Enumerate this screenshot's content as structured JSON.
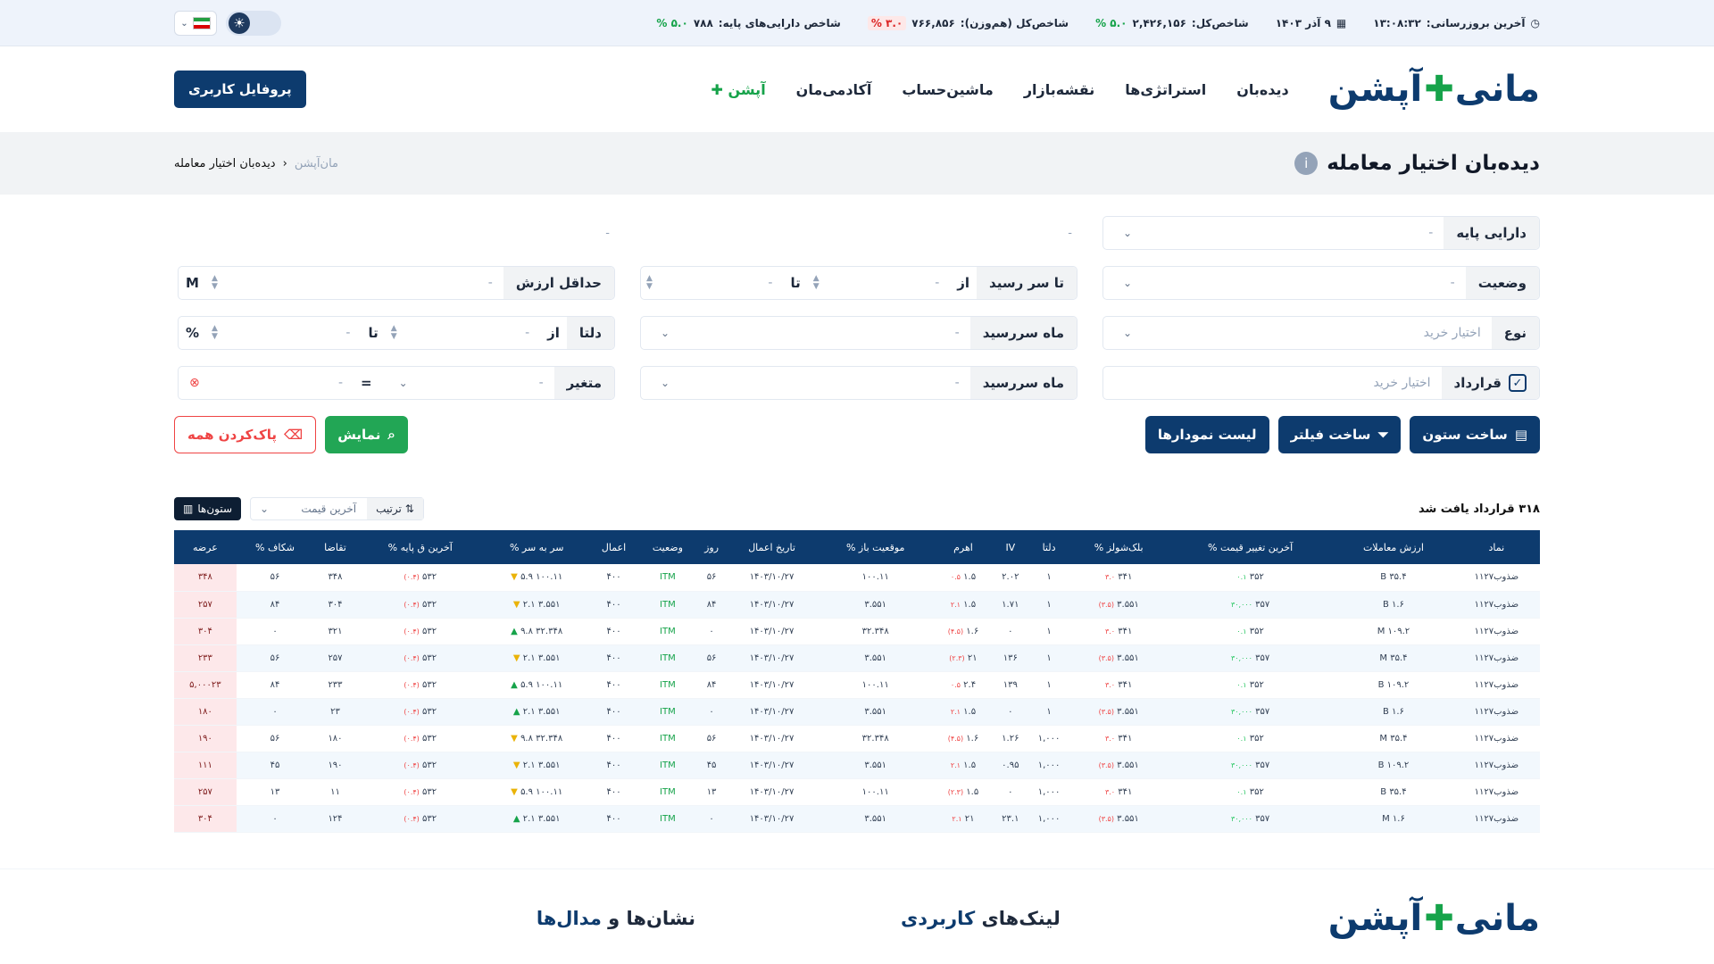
{
  "ticker": {
    "last_update_label": "آخرین بروزرسانی:",
    "last_update_time": "۱۳:۰۸:۳۲",
    "date": "۹ آذر ۱۴۰۳",
    "total_index_label": "شاخص‌کل:",
    "total_index_value": "۲,۴۲۶,۱۵۶",
    "total_index_change": "۵.۰ %",
    "eq_index_label": "شاخص‌کل (هم‌وزن):",
    "eq_index_value": "۷۶۶,۸۵۶",
    "eq_index_change": "۳.۰ %",
    "base_index_label": "شاخص دارایی‌های پایه:",
    "base_index_value": "۷۸۸",
    "base_index_change": "۵.۰ %"
  },
  "header": {
    "logo_a": "مانی",
    "logo_b": "آپشن",
    "nav": [
      "دیده‌بان",
      "استراتژی‌ها",
      "نقشه‌بازار",
      "ماشین‌حساب",
      "آکادمی‌مان",
      "آپشن"
    ],
    "profile": "پروفایل کاربری"
  },
  "page": {
    "title": "دیده‌بان اختیار معامله",
    "breadcrumb_root": "مان‌آپشن",
    "breadcrumb_current": "دیده‌بان اختیار معامله"
  },
  "filters": {
    "base_asset": "دارایی پایه",
    "status": "وضعیت",
    "type": "نوع",
    "type_value": "اختیار خرید",
    "contract": "قرارداد",
    "contract_value": "اختیار خرید",
    "to_maturity": "تا سر رسید",
    "from": "از",
    "to": "تا",
    "maturity_month": "ماه سررسید",
    "min_value": "حداقل ارزش",
    "unit_m": "M",
    "delta": "دلتا",
    "pct": "%",
    "variable": "متغیر",
    "eq": "=",
    "dash": "-"
  },
  "buttons": {
    "columns": "ساخت ستون",
    "filter": "ساخت فیلتر",
    "charts": "لیست نمودارها",
    "show": "نمایش",
    "clear": "پاک‌کردن همه"
  },
  "table": {
    "found": "۳۱۸  قرارداد یافت شد",
    "sort_label": "ترتیب",
    "sort_value": "آخرین قیمت",
    "columns_btn": "ستون‌ها",
    "headers": [
      "نماد",
      "ارزش معاملات",
      "آخرین تغییر قیمت %",
      "بلک‌شولز %",
      "دلتا",
      "IV",
      "اهرم",
      "موقعیت باز %",
      "تاریخ اعمال",
      "روز",
      "وضعیت",
      "اعمال",
      "سر به سر %",
      "آخرین ق پایه %",
      "تقاضا",
      "شکاف %",
      "عرضه"
    ],
    "rows": [
      [
        "ضذوب۱۱۲۷",
        "۳۵.۴ B",
        "۰.۱",
        "۳۵۲",
        "۳.۰",
        "۳۴۱",
        "۱",
        "۲.۰۲",
        "۱.۵",
        "۰.۵",
        "۱۰۰.۱۱",
        "۱۴۰۳/۱۰/۲۷",
        "۵۶",
        "ITM",
        "۴۰۰",
        "۵.۹",
        "▼",
        "۱۰۰.۱۱",
        "(۰.۴)",
        "۵۳۲",
        "۳۴۸",
        "۵۶",
        "۳۴۸"
      ],
      [
        "ضذوب۱۱۲۷",
        "۱.۶ B",
        "۳۰,۰۰۰",
        "۳۵۷",
        "(۳.۵)",
        "۳.۵۵۱",
        "۱",
        "۱.۷۱",
        "۱.۵",
        "۲.۱",
        "۳.۵۵۱",
        "۱۴۰۳/۱۰/۲۷",
        "۸۴",
        "ITM",
        "۴۰۰",
        "۲.۱",
        "▼",
        "۳.۵۵۱",
        "(۰.۴)",
        "۵۳۲",
        "۳۰۴",
        "۸۴",
        "۲۵۷"
      ],
      [
        "ضذوب۱۱۲۷",
        "۱۰۹.۲ M",
        "۰.۱",
        "۳۵۲",
        "۳.۰",
        "۳۴۱",
        "۱",
        "۰",
        "۱.۶",
        "(۴.۵)",
        "۳۲.۳۴۸",
        "۱۴۰۳/۱۰/۲۷",
        "۰",
        "ITM",
        "۴۰۰",
        "۹.۸",
        "▲",
        "۳۲.۳۴۸",
        "(۰.۴)",
        "۵۳۲",
        "۳۲۱",
        "۰",
        "۳۰۴"
      ],
      [
        "ضذوب۱۱۲۷",
        "۳۵.۴ M",
        "۳۰,۰۰۰",
        "۳۵۷",
        "(۳.۵)",
        "۳.۵۵۱",
        "۱",
        "۱۳۶",
        "۲۱",
        "(۲.۳)",
        "۳.۵۵۱",
        "۱۴۰۳/۱۰/۲۷",
        "۵۶",
        "ITM",
        "۴۰۰",
        "۲.۱",
        "▼",
        "۳.۵۵۱",
        "(۰.۴)",
        "۵۳۲",
        "۲۵۷",
        "۵۶",
        "۲۳۳"
      ],
      [
        "ضذوب۱۱۲۷",
        "۱۰۹.۲ B",
        "۰.۱",
        "۳۵۲",
        "۳.۰",
        "۳۴۱",
        "۱",
        "۱۳۹",
        "۲.۴",
        "۰.۵",
        "۱۰۰.۱۱",
        "۱۴۰۳/۱۰/۲۷",
        "۸۴",
        "ITM",
        "۴۰۰",
        "۵.۹",
        "▲",
        "۱۰۰.۱۱",
        "(۰.۴)",
        "۵۳۲",
        "۲۳۳",
        "۸۴",
        "۵,۰۰۰۲۳"
      ],
      [
        "ضذوب۱۱۲۷",
        "۱.۶ B",
        "۳۰,۰۰۰",
        "۳۵۷",
        "(۳.۵)",
        "۳.۵۵۱",
        "۱",
        "۰",
        "۱.۵",
        "۲.۱",
        "۳.۵۵۱",
        "۱۴۰۳/۱۰/۲۷",
        "۰",
        "ITM",
        "۴۰۰",
        "۲.۱",
        "▲",
        "۳.۵۵۱",
        "(۰.۴)",
        "۵۳۲",
        "۲۳",
        "۰",
        "۱۸۰"
      ],
      [
        "ضذوب۱۱۲۷",
        "۳۵.۴ M",
        "۰.۱",
        "۳۵۲",
        "۳.۰",
        "۳۴۱",
        "۱,۰۰۰",
        "۱.۲۶",
        "۱.۶",
        "(۴.۵)",
        "۳۲.۳۴۸",
        "۱۴۰۳/۱۰/۲۷",
        "۵۶",
        "ITM",
        "۴۰۰",
        "۹.۸",
        "▼",
        "۳۲.۳۴۸",
        "(۰.۴)",
        "۵۳۲",
        "۱۸۰",
        "۵۶",
        "۱۹۰"
      ],
      [
        "ضذوب۱۱۲۷",
        "۱۰۹.۲ B",
        "۳۰,۰۰۰",
        "۳۵۷",
        "(۳.۵)",
        "۳.۵۵۱",
        "۱,۰۰۰",
        "۰.۹۵",
        "۱.۵",
        "۲.۱",
        "۳.۵۵۱",
        "۱۴۰۳/۱۰/۲۷",
        "۴۵",
        "ITM",
        "۴۰۰",
        "۲.۱",
        "▼",
        "۳.۵۵۱",
        "(۰.۴)",
        "۵۳۲",
        "۱۹۰",
        "۴۵",
        "۱۱۱"
      ],
      [
        "ضذوب۱۱۲۷",
        "۳۵.۴ B",
        "۰.۱",
        "۳۵۲",
        "۳.۰",
        "۳۴۱",
        "۱,۰۰۰",
        "۰",
        "۱.۵",
        "(۲.۳)",
        "۱۰۰.۱۱",
        "۱۴۰۳/۱۰/۲۷",
        "۱۳",
        "ITM",
        "۴۰۰",
        "۵.۹",
        "▼",
        "۱۰۰.۱۱",
        "(۰.۴)",
        "۵۳۲",
        "۱۱",
        "۱۳",
        "۲۵۷"
      ],
      [
        "ضذوب۱۱۲۷",
        "۱.۶ M",
        "۳۰,۰۰۰",
        "۳۵۷",
        "(۳.۵)",
        "۳.۵۵۱",
        "۱,۰۰۰",
        "۲۳.۱",
        "۲۱",
        "۲.۱",
        "۳.۵۵۱",
        "۱۴۰۳/۱۰/۲۷",
        "۰",
        "ITM",
        "۴۰۰",
        "۲.۱",
        "▲",
        "۳.۵۵۱",
        "(۰.۴)",
        "۵۳۲",
        "۱۲۴",
        "۰",
        "۳۰۴"
      ]
    ]
  },
  "footer": {
    "links_a": "لینک‌های ",
    "links_b": "کاربردی",
    "badges_a": "نشان‌ها و ",
    "badges_b": "مدال‌ها"
  }
}
